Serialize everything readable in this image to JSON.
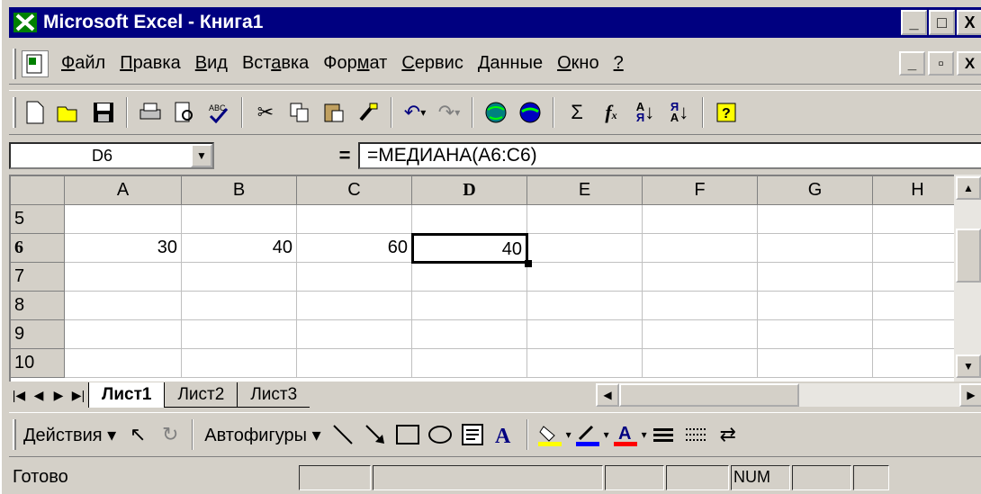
{
  "window": {
    "title": "Microsoft Excel - Книга1",
    "app_icon": "excel-x-icon",
    "controls": [
      "_",
      "□",
      "X"
    ]
  },
  "menu": {
    "items": [
      {
        "label": "Файл",
        "hotkey": "Ф"
      },
      {
        "label": "Правка",
        "hotkey": "П"
      },
      {
        "label": "Вид",
        "hotkey": "В"
      },
      {
        "label": "Вставка",
        "hotkey": "а"
      },
      {
        "label": "Формат",
        "hotkey": "м"
      },
      {
        "label": "Сервис",
        "hotkey": "С"
      },
      {
        "label": "Данные",
        "hotkey": "Д"
      },
      {
        "label": "Окно",
        "hotkey": "О"
      },
      {
        "label": "?",
        "hotkey": "?"
      }
    ],
    "mdi_controls": [
      "_",
      "▫",
      "X"
    ]
  },
  "toolbar": {
    "icons": [
      "new-icon",
      "open-icon",
      "save-icon",
      "print-icon",
      "print-preview-icon",
      "spelling-icon",
      "cut-icon",
      "copy-icon",
      "paste-icon",
      "format-painter-icon",
      "undo-icon",
      "redo-icon",
      "web-icon",
      "hyperlink-icon",
      "autosum-icon",
      "function-icon",
      "sort-asc-icon",
      "sort-desc-icon",
      "help-icon"
    ]
  },
  "formula_bar": {
    "name_box": "D6",
    "equals": "=",
    "formula": "=МЕДИАНА(A6:C6)"
  },
  "grid": {
    "columns": [
      "A",
      "B",
      "C",
      "D",
      "E",
      "F",
      "G",
      "H"
    ],
    "rows": [
      "5",
      "6",
      "7",
      "8",
      "9",
      "10"
    ],
    "active_column": "D",
    "active_row": "6",
    "cells": {
      "A6": "30",
      "B6": "40",
      "C6": "60",
      "D6": "40"
    }
  },
  "sheets": {
    "tabs": [
      "Лист1",
      "Лист2",
      "Лист3"
    ],
    "active": "Лист1"
  },
  "drawing_toolbar": {
    "actions_label": "Действия ▾",
    "autoshapes_label": "Автофигуры ▾"
  },
  "status": {
    "ready": "Готово",
    "num": "NUM"
  }
}
